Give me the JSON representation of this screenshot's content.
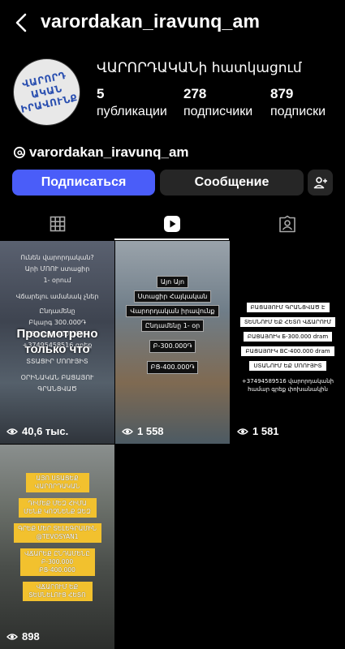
{
  "header": {
    "username": "varordakan_iravunq_am"
  },
  "profile": {
    "avatar_lines": [
      "ՎԱՐՈՐԴ",
      "ԱԿԱՆ",
      "ԻՐԱՎՈՒՆՔ"
    ],
    "display_name": "ՎԱՐՈՐԴԱԿԱՆի հատկացում",
    "stats": {
      "posts": {
        "value": "5",
        "label": "публикации"
      },
      "followers": {
        "value": "278",
        "label": "подписчики"
      },
      "following": {
        "value": "879",
        "label": "подписки"
      }
    },
    "threads_handle": "varordakan_iravunq_am"
  },
  "actions": {
    "follow_label": "Подписаться",
    "message_label": "Сообщение"
  },
  "tabs": [
    {
      "name": "grid",
      "icon": "grid-icon"
    },
    {
      "name": "reels",
      "icon": "reels-icon",
      "active": true
    },
    {
      "name": "tagged",
      "icon": "tagged-icon"
    }
  ],
  "posts": [
    {
      "lines": [
        "Ունեն վարորդական?",
        "Արի ՄՈՈՒ ստացիր",
        "1- օրում",
        "Վճարելու ամանակ չներ",
        "Ընդամենը",
        "Բկարգ 300.000֏",
        "ԲՑկարգ 400.000֏",
        "+37495458516 գրեք",
        "ՏՏԱՑԻՐ ՄՈՈՒՅԻՏ",
        "ՕՐԻՆԱԿԱՆ ԲԱՑԱՅՈՒ",
        "ԳՐԱՆՑՎԱԾ"
      ],
      "overlay": "Просмотрено только что",
      "views": "40,6 тыс."
    },
    {
      "lines": [
        "Այո Այո",
        "Ստացիր Հայկական",
        "Վարորդական իրավունք",
        "Ընդամենը 1- օր",
        "Բ-300.000֏",
        "ԲՑ-400.000֏"
      ],
      "views": "1 558"
    },
    {
      "lines": [
        "ԲԱՑԱՅՈՒՄ ԳՐԱՆՑՎԱԾ Է",
        "ՏԵՍՆՈՒՄ ԵՔ ՀԵՏՈ ՎՃԱՐՈՒՄ",
        "ԲԱՑԱՅՈՒԿ Б-300.000 dram",
        "ԲԱՑԱՅՈՒԿ ВС-400.000 dram",
        "ՍՏԱՆՈՒՄ ԵՔ ՄՈՈՒՅԻՏ",
        "+37494589516 վարորդականի համար գրեք փոխանակին"
      ],
      "views": "1 581"
    },
    {
      "lines": [
        "ԱՅՈ ՍՏԱՑԵՔ ՎԱՐՈՐԴԱԿԱՆ",
        "ԴԻՄԵՔ ՄԵԶ ՀԻՄԱ ՄԵՆՔ ԿՈՉՆԵՆՔ ՁԵԶ",
        "ԳՐԵՔ ՄԵՐ ՏԵԼԵԳՐԱՄԻՆ @TEVOSYAN1",
        "ՎՃԱՐԵՔ ԸՆԴԱՄԵՆԸ Բ-300.000 ԲՑ-400.000",
        "ՎՃԱՐՈՒՄ ԵՔ ՏԵՍՆԵԼՈՒՑ ՀԵՏՈ"
      ],
      "views": "898"
    }
  ],
  "colors": {
    "follow_button": "#4a5df9",
    "secondary_button": "#262626",
    "yellow_box": "#f2c12e"
  }
}
